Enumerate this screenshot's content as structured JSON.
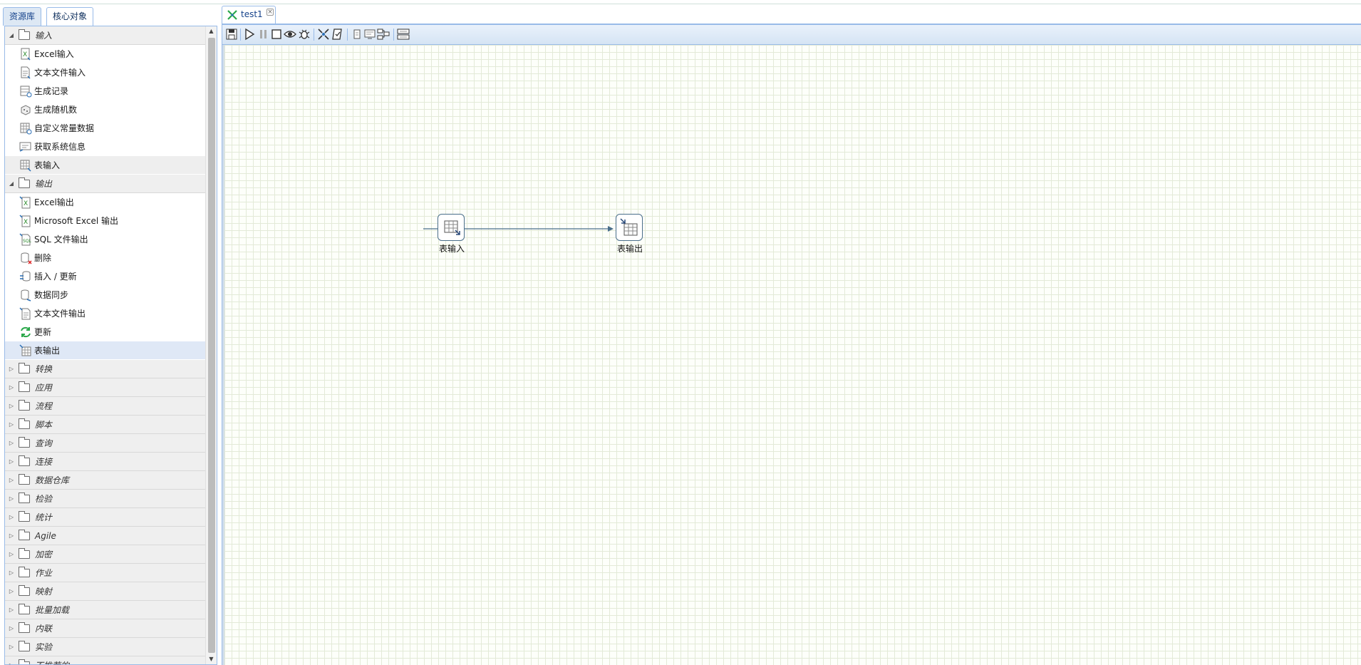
{
  "left_tabs": [
    {
      "label": "资源库"
    },
    {
      "label": "核心对象"
    }
  ],
  "tree": {
    "input": {
      "label": "输入",
      "items": [
        "Excel输入",
        "文本文件输入",
        "生成记录",
        "生成随机数",
        "自定义常量数据",
        "获取系统信息",
        "表输入"
      ]
    },
    "output": {
      "label": "输出",
      "items": [
        "Excel输出",
        "Microsoft Excel 输出",
        "SQL 文件输出",
        "删除",
        "插入 / 更新",
        "数据同步",
        "文本文件输出",
        "更新",
        "表输出"
      ]
    },
    "collapsed": [
      "转换",
      "应用",
      "流程",
      "脚本",
      "查询",
      "连接",
      "数据仓库",
      "检验",
      "统计",
      "Agile",
      "加密",
      "作业",
      "映射",
      "批量加载",
      "内联",
      "实验",
      "不推荐的"
    ]
  },
  "document_tab": {
    "label": "test1",
    "close_label": "×"
  },
  "toolbar": {
    "buttons": [
      "save-icon",
      "run-icon",
      "pause-icon",
      "stop-icon",
      "preview-icon",
      "debug-icon",
      "replay-icon",
      "verify-icon",
      "impact-icon",
      "sql-icon",
      "dependency-icon",
      "align-icon"
    ]
  },
  "canvas": {
    "nodes": [
      {
        "label": "表输入",
        "icon": "table-input-icon"
      },
      {
        "label": "表输出",
        "icon": "table-output-icon"
      }
    ],
    "hop": {
      "from": "表输入",
      "to": "表输出"
    }
  },
  "colors": {
    "panel_border": "#99bbe8",
    "selected_row": "#dfe8f6",
    "hop_line": "#4a6e8a"
  }
}
